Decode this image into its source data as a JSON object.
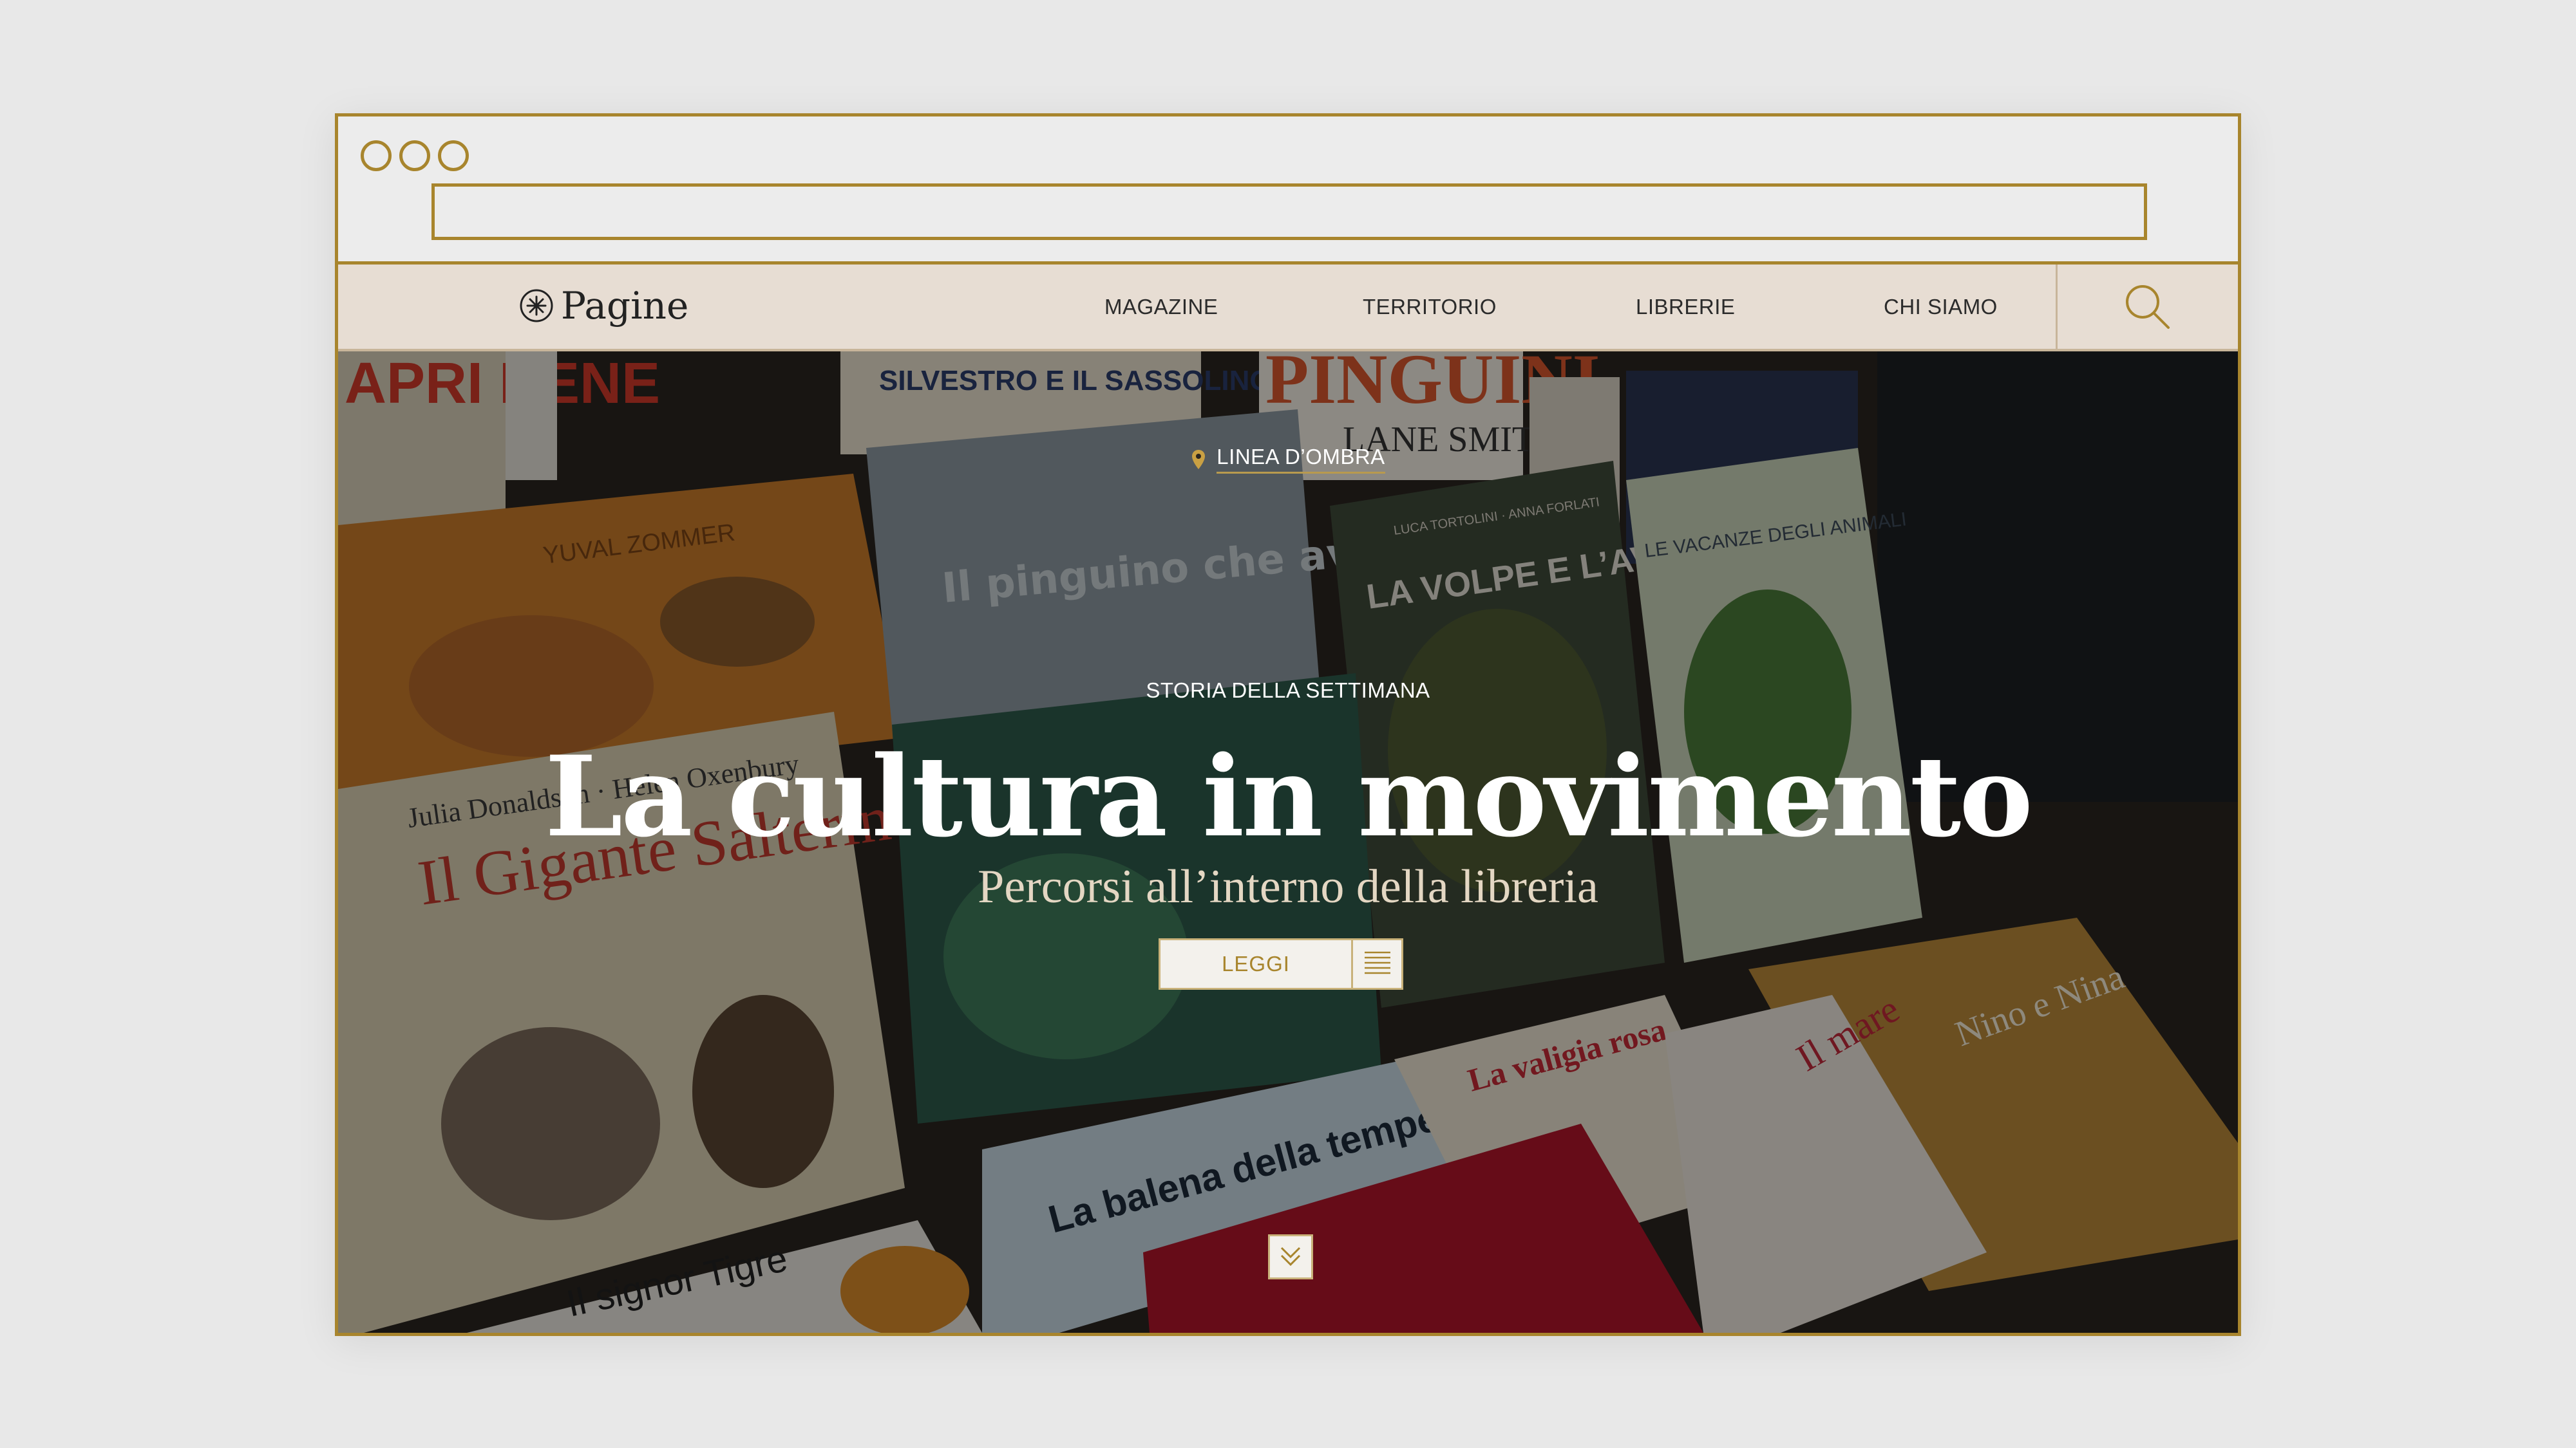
{
  "site": {
    "logo_text": "Pagine",
    "logo_icon": "asterisk-circle-icon"
  },
  "nav": {
    "items": [
      {
        "label": "MAGAZINE"
      },
      {
        "label": "TERRITORIO"
      },
      {
        "label": "LIBRERIE"
      },
      {
        "label": "CHI SIAMO"
      }
    ],
    "search_icon": "search-icon"
  },
  "hero": {
    "location": "LINEA D’OMBRA",
    "kicker": "STORIA DELLA SETTIMANA",
    "title": "La cultura in movimento",
    "subtitle": "Percorsi all’interno della libreria",
    "read_button": "LEGGI",
    "list_icon": "list-icon",
    "scroll_icon": "chevron-double-down-icon",
    "background_titles": {
      "b1": "Il Gigante Salterino",
      "b1_author": "Julia Donaldson · Helen Oxenbury",
      "b2": "Il pinguino che aveva freddo",
      "b3": "LA VOLPE E L’AVIATORE",
      "b4": "LE VACANZE DEGLI ANIMALI",
      "b5": "Nino e Nina",
      "b6": "La balena della tempesta",
      "b7": "La valigia rosa",
      "b8": "PINGUINI",
      "b9": "SILVESTRO E IL SASSOLINO MAGICO",
      "b10": "Il signor Tigre",
      "b11": "YUVAL ZOMMER",
      "b12": "LANE SMITH",
      "b13": "APRI BENE",
      "b14": "Il mare",
      "b15": "LUCA TORTOLINI · ANNA FORLATI"
    }
  },
  "colors": {
    "accent": "#a8852d",
    "nav_bg": "#e7ddd3",
    "chrome_bg": "#ececec"
  }
}
